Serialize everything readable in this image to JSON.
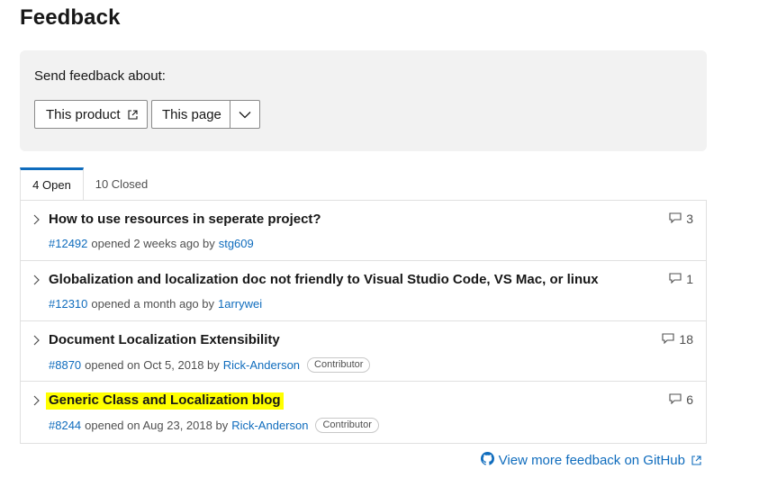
{
  "page": {
    "title": "Feedback"
  },
  "send": {
    "label": "Send feedback about:",
    "product_button": "This product",
    "page_select": "This page"
  },
  "tabs": {
    "open_label": "4 Open",
    "closed_label": "10 Closed"
  },
  "issues": [
    {
      "title": "How to use resources in seperate project?",
      "number": "#12492",
      "opened": "opened 2 weeks ago by",
      "author": "stg609",
      "badge": "",
      "comments": "3",
      "highlighted": false
    },
    {
      "title": "Globalization and localization doc not friendly to Visual Studio Code, VS Mac, or linux",
      "number": "#12310",
      "opened": "opened a month ago by",
      "author": "1arrywei",
      "badge": "",
      "comments": "1",
      "highlighted": false
    },
    {
      "title": "Document Localization Extensibility",
      "number": "#8870",
      "opened": "opened on Oct 5, 2018 by",
      "author": "Rick-Anderson",
      "badge": "Contributor",
      "comments": "18",
      "highlighted": false
    },
    {
      "title": "Generic Class and Localization blog",
      "number": "#8244",
      "opened": "opened on Aug 23, 2018 by",
      "author": "Rick-Anderson",
      "badge": "Contributor",
      "comments": "6",
      "highlighted": true
    }
  ],
  "footer": {
    "github_link": "View more feedback on GitHub"
  },
  "colors": {
    "accent": "#0f6cbd",
    "highlight": "#ffff00",
    "panel_bg": "#f2f2f2"
  },
  "icons": {
    "external": "external-link-icon",
    "dropdown": "chevron-down-icon",
    "expand": "chevron-right-icon",
    "comment": "comment-icon",
    "github": "github-icon"
  }
}
